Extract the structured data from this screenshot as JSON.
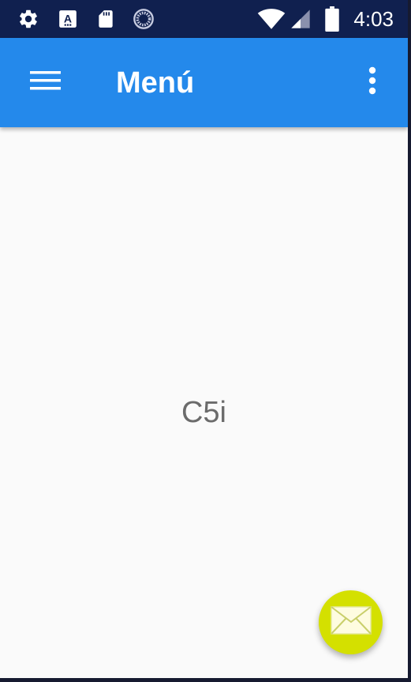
{
  "status_bar": {
    "time": "4:03",
    "icons": [
      "gear-icon",
      "font-a-icon",
      "sd-card-icon",
      "sync-circle-icon",
      "wifi-icon",
      "cell-signal-icon",
      "battery-icon"
    ]
  },
  "app_bar": {
    "title": "Menú",
    "nav_icon": "hamburger-menu-icon",
    "overflow_icon": "more-vert-icon"
  },
  "content": {
    "center_text": "C5i"
  },
  "fab": {
    "icon": "mail-icon",
    "color": "#d4e000"
  },
  "colors": {
    "status_bar": "#10204f",
    "app_bar": "#2489eb",
    "background": "#fafafa",
    "text": "#6b6b6b"
  }
}
